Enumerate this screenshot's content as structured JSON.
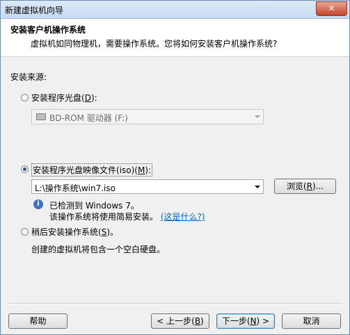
{
  "window": {
    "title": "新建虚拟机向导",
    "close_label": "✕"
  },
  "header": {
    "title": "安装客户机操作系统",
    "subtitle": "虚拟机如同物理机，需要操作系统。您将如何安装客户机操作系统?"
  },
  "install_source": {
    "label": "安装来源:",
    "disc_option": {
      "label": "安装程序光盘(",
      "key": "D",
      "suffix": "):",
      "checked": false
    },
    "disc_combo": {
      "value": "BD-ROM 驱动器 (F:)",
      "enabled": false
    },
    "iso_option": {
      "label": "安装程序光盘映像文件(iso)(",
      "key": "M",
      "suffix": "):",
      "checked": true
    },
    "iso_combo": {
      "value": "L:\\操作系统\\win7.iso"
    },
    "browse_button": {
      "label": "浏览(",
      "key": "R",
      "suffix": ")..."
    },
    "detected_line1": "已检测到 Windows 7。",
    "detected_line2": "该操作系统将使用简易安装。",
    "what_link": "(这是什么?)",
    "later_option": {
      "label": "稍后安装操作系统(",
      "key": "S",
      "suffix": ")。",
      "checked": false
    },
    "later_desc": "创建的虚拟机将包含一个空白硬盘。"
  },
  "footer": {
    "help_label": "帮助",
    "back": {
      "label": "< 上一步(",
      "key": "B",
      "suffix": ")"
    },
    "next": {
      "label": "下一步(",
      "key": "N",
      "suffix": ") >"
    },
    "cancel_label": "取消"
  }
}
